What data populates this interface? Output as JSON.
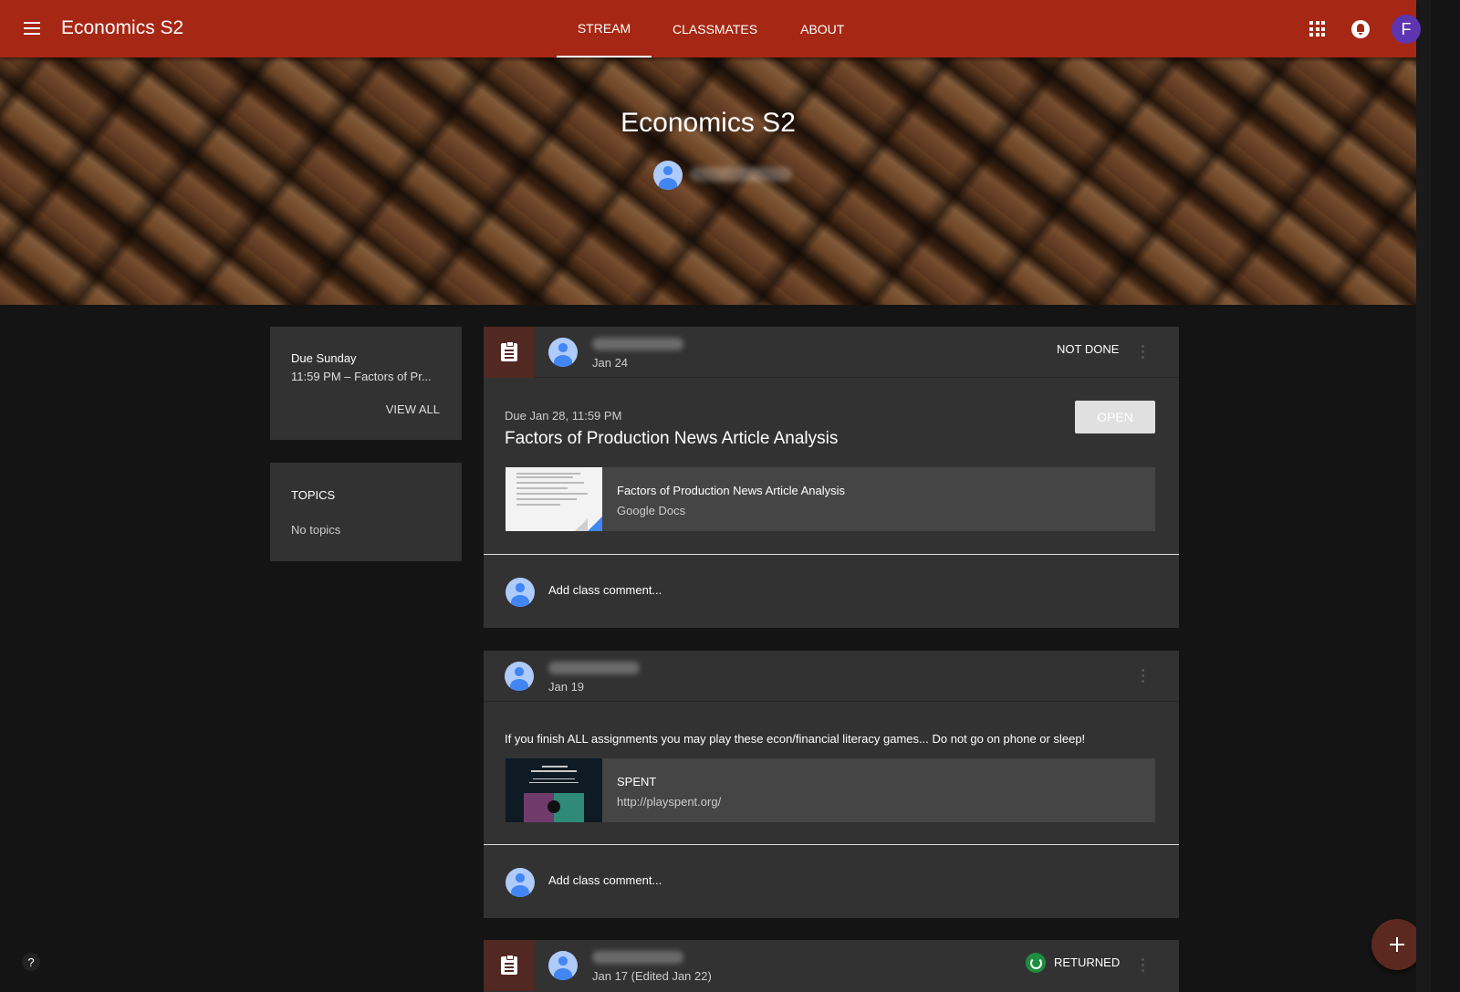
{
  "header": {
    "title": "Economics S2",
    "tabs": [
      {
        "label": "STREAM",
        "active": true
      },
      {
        "label": "CLASSMATES",
        "active": false
      },
      {
        "label": "ABOUT",
        "active": false
      }
    ],
    "account_initial": "F",
    "colors": {
      "bar": "#a52714",
      "avatar": "#5e35b1"
    }
  },
  "banner": {
    "class_name": "Economics S2"
  },
  "upcoming": {
    "due_title": "Due Sunday",
    "due_item": "11:59 PM – Factors of Pr...",
    "view_all": "VIEW ALL"
  },
  "topics": {
    "title": "TOPICS",
    "empty_text": "No topics"
  },
  "posts": [
    {
      "date": "Jan 24",
      "status": "NOT DONE",
      "due": "Due Jan 28, 11:59 PM",
      "title": "Factors of Production News Article Analysis",
      "open_label": "OPEN",
      "attachment": {
        "title": "Factors of Production News Article Analysis",
        "subtitle": "Google Docs"
      },
      "comment_placeholder": "Add class comment..."
    },
    {
      "date": "Jan 19",
      "text": "If you finish ALL assignments you may play these econ/financial literacy games... Do not go on phone or sleep!",
      "attachment": {
        "title": "SPENT",
        "subtitle": "http://playspent.org/"
      },
      "comment_placeholder": "Add class comment..."
    },
    {
      "date": "Jan 17 (Edited Jan 22)",
      "status": "RETURNED"
    }
  ],
  "help_label": "?"
}
